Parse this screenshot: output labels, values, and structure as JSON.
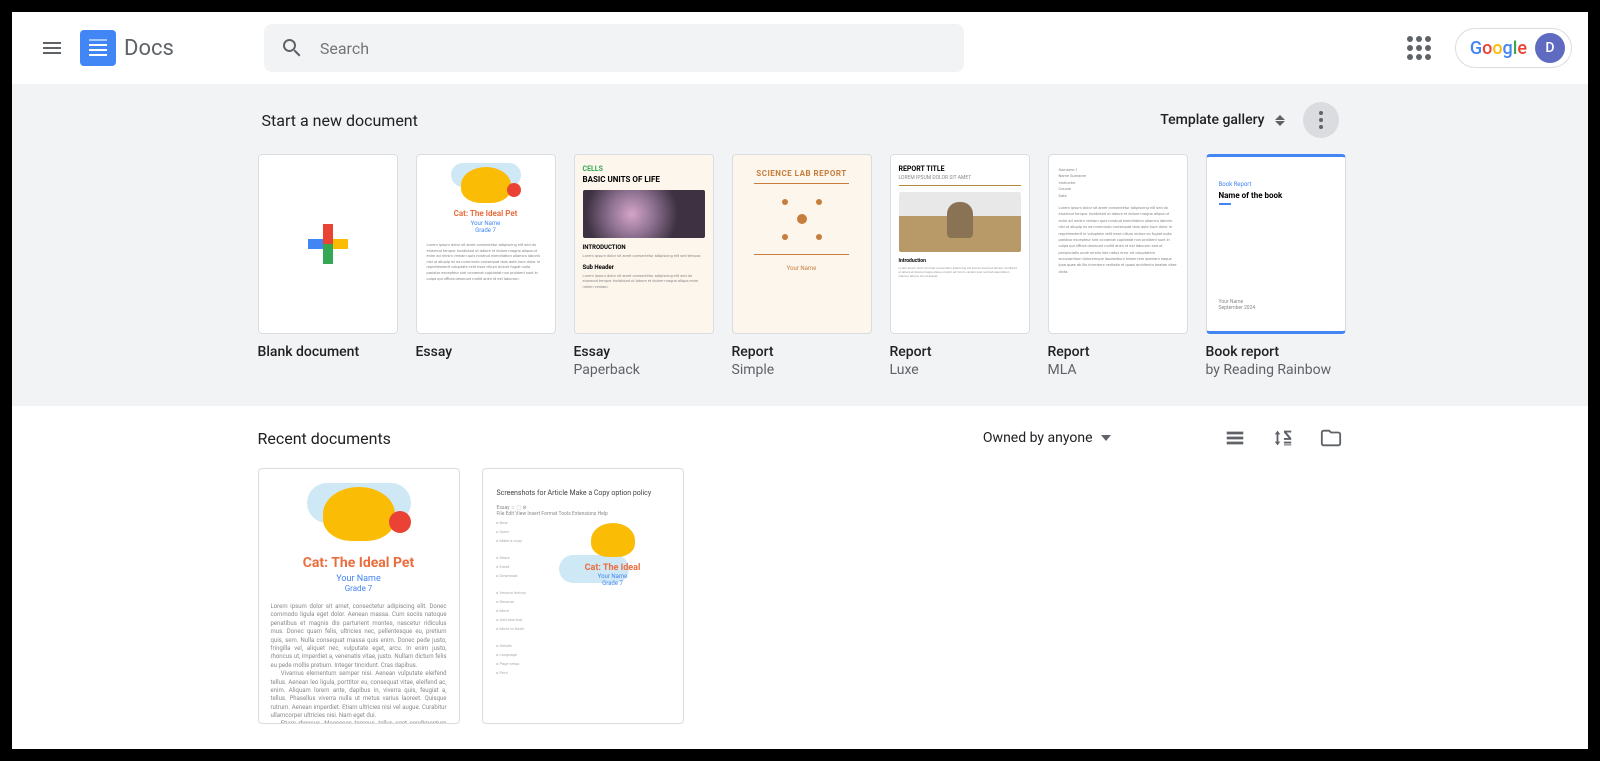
{
  "header": {
    "app_name": "Docs",
    "search_placeholder": "Search",
    "avatar_initial": "D"
  },
  "templates": {
    "section_title": "Start a new document",
    "gallery_label": "Template gallery",
    "items": [
      {
        "name": "Blank document",
        "subtitle": ""
      },
      {
        "name": "Essay",
        "subtitle": ""
      },
      {
        "name": "Essay",
        "subtitle": "Paperback"
      },
      {
        "name": "Report",
        "subtitle": "Simple"
      },
      {
        "name": "Report",
        "subtitle": "Luxe"
      },
      {
        "name": "Report",
        "subtitle": "MLA"
      },
      {
        "name": "Book report",
        "subtitle": "by Reading Rainbow"
      }
    ]
  },
  "recent": {
    "section_title": "Recent documents",
    "owner_filter": "Owned by anyone"
  },
  "thumb_text": {
    "essay_title": "Cat: The Ideal Pet",
    "essay_name": "Your Name",
    "essay_grade": "Grade 7",
    "paperback_tag": "CELLS",
    "paperback_title": "BASIC UNITS OF LIFE",
    "paperback_intro": "INTRODUCTION",
    "paperback_sub": "Sub Header",
    "simple_title": "SCIENCE LAB REPORT",
    "simple_name": "Your Name",
    "luxe_title": "REPORT TITLE",
    "luxe_sub": "LOREM IPSUM DOLOR SIT AMET",
    "luxe_intro": "Introduction",
    "book_tag": "Book Report",
    "book_title": "Name of the book",
    "doc2_title": "Screenshots for Article Make a Copy option policy"
  }
}
